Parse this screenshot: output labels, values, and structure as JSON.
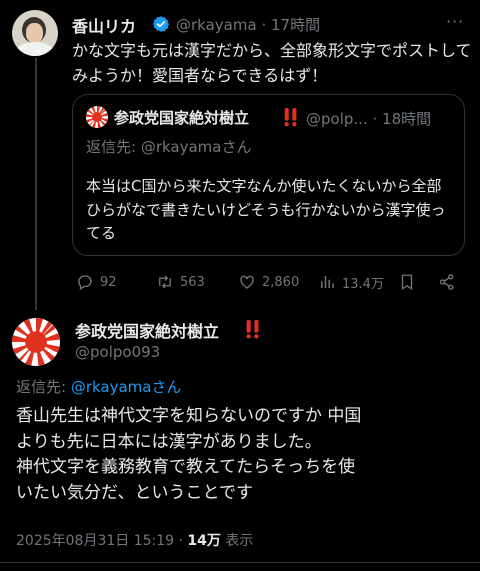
{
  "top_tweet": {
    "author_name": "香山リカ",
    "handle": "@rkayama",
    "separator": "·",
    "time": "17時間",
    "more_label": "···",
    "text": "かな文字も元は漢字だから、全部象形文字でポストしてみようか！愛国者ならできるはず！",
    "quote": {
      "author_name": "参政党国家絶対樹立",
      "handle": "@polp...",
      "separator": "·",
      "time": "18時間",
      "reply_prefix": "返信先: ",
      "reply_to": "@rkayamaさん",
      "text": "本当はC国から来た文字なんか使いたくないから全部ひらがなで書きたいけどそうも行かないから漢字使ってる"
    },
    "actions": {
      "replies": "92",
      "reposts": "563",
      "likes": "2,860",
      "views": "13.4万"
    }
  },
  "main_tweet": {
    "author_name": "参政党国家絶対樹立",
    "handle": "@polpo093",
    "reply_prefix": "返信先: ",
    "reply_to": "@rkayamaさん",
    "text_lines": [
      "香山先生は神代文字を知らないのですか 中国",
      "よりも先に日本には漢字がありました。",
      "神代文字を義務教育で教えてたらそっちを使",
      "いたい気分だ、ということです"
    ],
    "date": "2025年08月31日 15:19",
    "dot": " · ",
    "views_count": "14万",
    "views_label": " 表示"
  },
  "colors": {
    "background": "#000000",
    "text": "#e7e9ea",
    "muted": "#71767b",
    "link": "#1d9bf0",
    "verified": "#1d9bf0",
    "border": "#2f3336",
    "sun_red": "#e0301e"
  },
  "icons": [
    "verified-badge-icon",
    "more-icon",
    "reply-icon",
    "repost-icon",
    "like-icon",
    "views-icon",
    "bookmark-icon",
    "share-icon",
    "double-exclamation-icon"
  ]
}
